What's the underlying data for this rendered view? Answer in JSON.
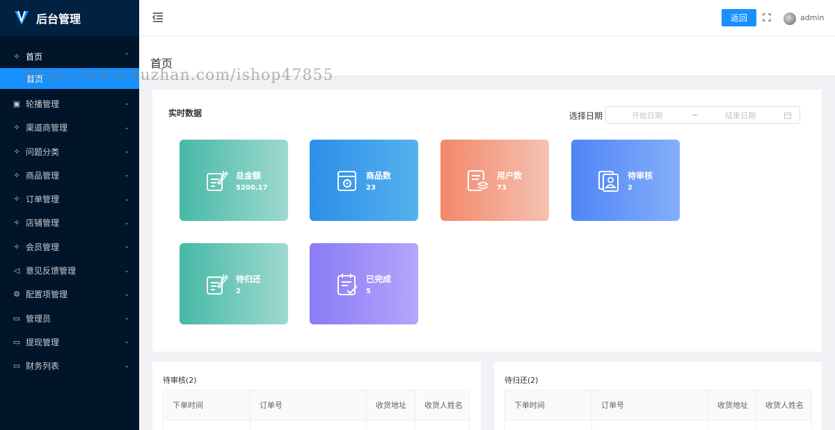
{
  "app": {
    "title": "后台管理"
  },
  "sidebar": {
    "items": [
      {
        "label": "首页",
        "icon": "user-group-icon",
        "open": true,
        "children": [
          {
            "label": "首页"
          }
        ]
      },
      {
        "label": "轮播管理",
        "icon": "image-icon"
      },
      {
        "label": "渠道商管理",
        "icon": "user-group-icon"
      },
      {
        "label": "问题分类",
        "icon": "user-group-icon"
      },
      {
        "label": "商品管理",
        "icon": "user-group-icon"
      },
      {
        "label": "订单管理",
        "icon": "user-group-icon"
      },
      {
        "label": "店铺管理",
        "icon": "user-group-icon"
      },
      {
        "label": "会员管理",
        "icon": "user-group-icon"
      },
      {
        "label": "意见反馈管理",
        "icon": "megaphone-icon"
      },
      {
        "label": "配置项管理",
        "icon": "gear-icon"
      },
      {
        "label": "管理员",
        "icon": "folder-icon"
      },
      {
        "label": "提现管理",
        "icon": "folder-icon"
      },
      {
        "label": "财务列表",
        "icon": "folder-icon"
      }
    ]
  },
  "header": {
    "back_label": "返回",
    "username": "admin"
  },
  "page": {
    "title": "首页"
  },
  "watermark": "https://www.huzhan.com/ishop47855",
  "stats": {
    "title": "实时数据",
    "date_label": "选择日期",
    "date_start_placeholder": "开始日期",
    "date_separator": "~",
    "date_end_placeholder": "结束日期",
    "cards": [
      {
        "label": "总金额",
        "value": "5200.17",
        "icon": "edit-document-icon",
        "color": "#46b9a7"
      },
      {
        "label": "商品数",
        "value": "23",
        "icon": "product-box-icon",
        "color": "#2c8ee8"
      },
      {
        "label": "用户数",
        "value": "73",
        "icon": "document-stack-icon",
        "color": "#f2886a"
      },
      {
        "label": "待审核",
        "value": "2",
        "icon": "id-card-icon",
        "color": "#4f86f7"
      },
      {
        "label": "待归还",
        "value": "2",
        "icon": "edit-document-icon",
        "color": "#46b9a7"
      },
      {
        "label": "已完成",
        "value": "5",
        "icon": "checklist-icon",
        "color": "#8a7af7"
      }
    ]
  },
  "tables": [
    {
      "title": "待审核(2)",
      "columns": [
        "下单时间",
        "订单号",
        "收货地址",
        "收货人姓名"
      ]
    },
    {
      "title": "待归还(2)",
      "columns": [
        "下单时间",
        "订单号",
        "收货地址",
        "收货人姓名"
      ]
    }
  ]
}
